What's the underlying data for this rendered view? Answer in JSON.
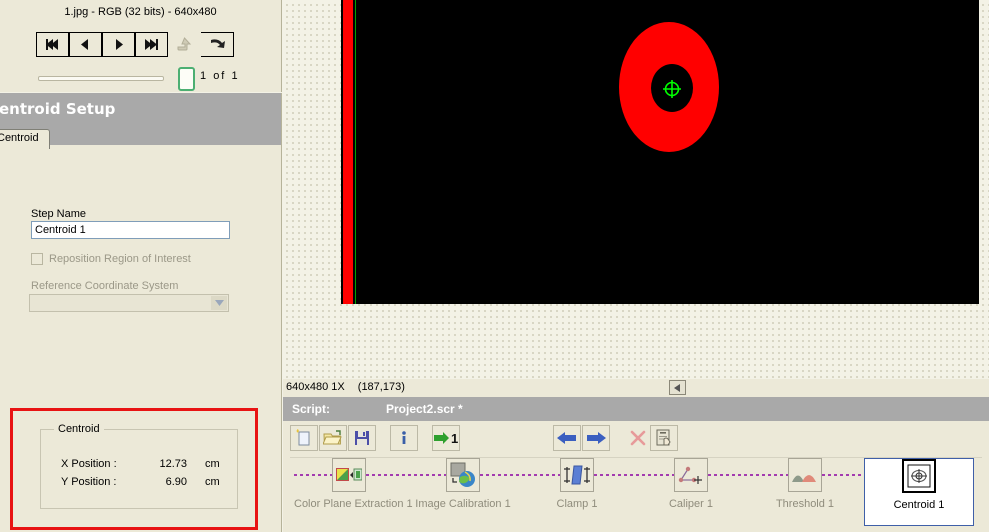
{
  "app": {
    "backdrop": "checkered-mdi-background",
    "accent_highlight_color": "#e81313",
    "titlebar_color": "#a9a9a9",
    "panel_color": "#ece9d8"
  },
  "image_nav": {
    "title": "1.jpg - RGB (32 bits) - 640x480",
    "buttons": [
      {
        "name": "first-image-button",
        "icon": "skip-back-icon",
        "enabled": true
      },
      {
        "name": "previous-image-button",
        "icon": "previous-icon",
        "enabled": true
      },
      {
        "name": "next-image-button",
        "icon": "next-icon",
        "enabled": true
      },
      {
        "name": "last-image-button",
        "icon": "skip-forward-icon",
        "enabled": true
      },
      {
        "name": "browse-up-button",
        "icon": "up-arrow-icon",
        "enabled": false
      },
      {
        "name": "return-button",
        "icon": "return-arrow-icon",
        "enabled": true
      }
    ],
    "slider": {
      "position": "end"
    },
    "counter_current": "1",
    "counter_separator": "of",
    "counter_total": "1"
  },
  "setup_panel": {
    "title": "Centroid Setup",
    "tab_label": "Centroid",
    "step_name_label": "Step Name",
    "step_name_value": "Centroid 1",
    "reposition_label": "Reposition Region of Interest",
    "reposition_checked": false,
    "reference_coord_label": "Reference Coordinate System",
    "reference_coord_value": "",
    "results": {
      "group_title": "Centroid",
      "rows": [
        {
          "label": "X Position :",
          "value": "12.73",
          "unit": "cm"
        },
        {
          "label": "Y Position :",
          "value": "6.90",
          "unit": "cm"
        }
      ]
    }
  },
  "image_view": {
    "status_size_zoom": "640x480 1X",
    "status_coords": "(187,173)",
    "overlay": {
      "roi_bar_color": "#ff0000",
      "roi_line_color": "#00a000",
      "blob_color": "#ff0000",
      "centroid_marker_color": "#00ff00"
    }
  },
  "script_pane": {
    "label": "Script:",
    "file": "Project2.scr *",
    "toolbar": [
      {
        "name": "new-script-button",
        "icon": "new-file-icon",
        "enabled": true
      },
      {
        "name": "open-script-button",
        "icon": "open-folder-icon",
        "enabled": true
      },
      {
        "name": "save-script-button",
        "icon": "save-disk-icon",
        "enabled": true
      },
      {
        "name": "script-info-button",
        "icon": "info-icon",
        "enabled": true
      },
      {
        "name": "run-once-button",
        "icon": "run-once-icon",
        "enabled": true
      },
      {
        "name": "step-back-button",
        "icon": "arrow-left-icon",
        "enabled": true
      },
      {
        "name": "step-forward-button",
        "icon": "arrow-right-icon",
        "enabled": true
      },
      {
        "name": "delete-step-button",
        "icon": "delete-x-icon",
        "enabled": false
      },
      {
        "name": "copy-step-button",
        "icon": "clipboard-hand-icon",
        "enabled": true
      }
    ],
    "steps": [
      {
        "name": "step-color-plane-extraction",
        "label": "Color Plane Extraction 1",
        "icon": "color-plane-extraction-icon",
        "selected": false
      },
      {
        "name": "step-image-calibration",
        "label": "Image Calibration 1",
        "icon": "image-calibration-icon",
        "selected": false
      },
      {
        "name": "step-clamp",
        "label": "Clamp 1",
        "icon": "clamp-icon",
        "selected": false
      },
      {
        "name": "step-caliper",
        "label": "Caliper 1",
        "icon": "caliper-icon",
        "selected": false
      },
      {
        "name": "step-threshold",
        "label": "Threshold 1",
        "icon": "threshold-icon",
        "selected": false
      },
      {
        "name": "step-centroid",
        "label": "Centroid 1",
        "icon": "centroid-icon",
        "selected": true
      }
    ]
  }
}
